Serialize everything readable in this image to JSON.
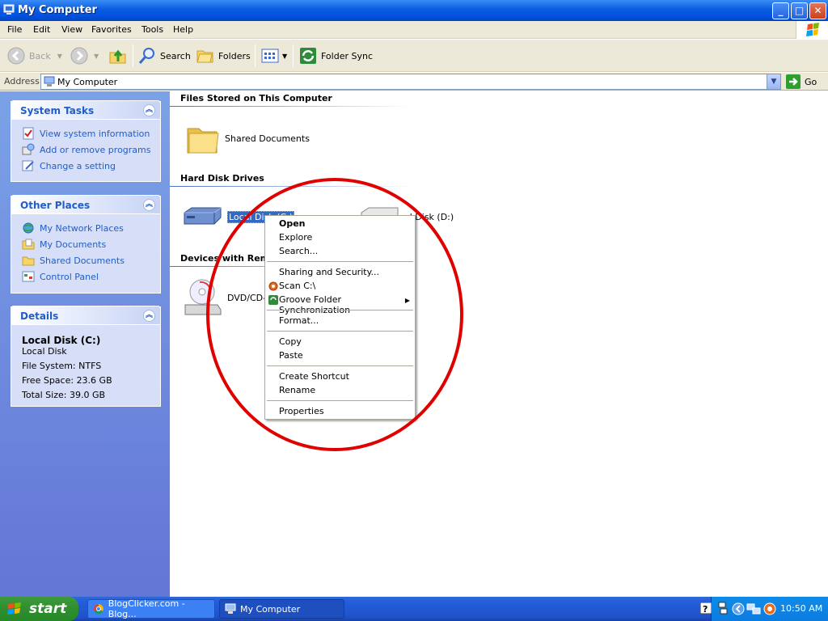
{
  "window": {
    "title": "My Computer",
    "minimize": "_",
    "maximize": "□",
    "close": "✕"
  },
  "menubar": [
    "File",
    "Edit",
    "View",
    "Favorites",
    "Tools",
    "Help"
  ],
  "toolbar": {
    "back": "Back",
    "search": "Search",
    "folders": "Folders",
    "folder_sync": "Folder Sync"
  },
  "address": {
    "label": "Address",
    "value": "My Computer",
    "go": "Go"
  },
  "sidebar": {
    "system_tasks": {
      "title": "System Tasks",
      "items": [
        "View system information",
        "Add or remove programs",
        "Change a setting"
      ]
    },
    "other_places": {
      "title": "Other Places",
      "items": [
        "My Network Places",
        "My Documents",
        "Shared Documents",
        "Control Panel"
      ]
    },
    "details": {
      "title": "Details",
      "name": "Local Disk (C:)",
      "type": "Local Disk",
      "file_system": "File System: NTFS",
      "free_space": "Free Space: 23.6 GB",
      "total_size": "Total Size: 39.0 GB"
    }
  },
  "content": {
    "files_section": "Files Stored on This Computer",
    "shared_documents": "Shared Documents",
    "hdd_section": "Hard Disk Drives",
    "local_disk_c": "Local Disk (C:)",
    "local_disk_d": "al Disk (D:)",
    "devices_section": "Devices with Remo",
    "dvd": "DVD/CD-R"
  },
  "context_menu": {
    "open": "Open",
    "explore": "Explore",
    "search": "Search...",
    "sharing": "Sharing and Security...",
    "scan": "Scan C:\\",
    "groove": "Groove Folder Synchronization",
    "format": "Format...",
    "copy": "Copy",
    "paste": "Paste",
    "create_shortcut": "Create Shortcut",
    "rename": "Rename",
    "properties": "Properties"
  },
  "taskbar": {
    "start": "start",
    "tasks": [
      "BlogClicker.com - Blog...",
      "My Computer"
    ],
    "clock": "10:50 AM"
  },
  "colors": {
    "annotation_circle": "#e00000",
    "link": "#215dc6",
    "selection": "#316ac5"
  }
}
